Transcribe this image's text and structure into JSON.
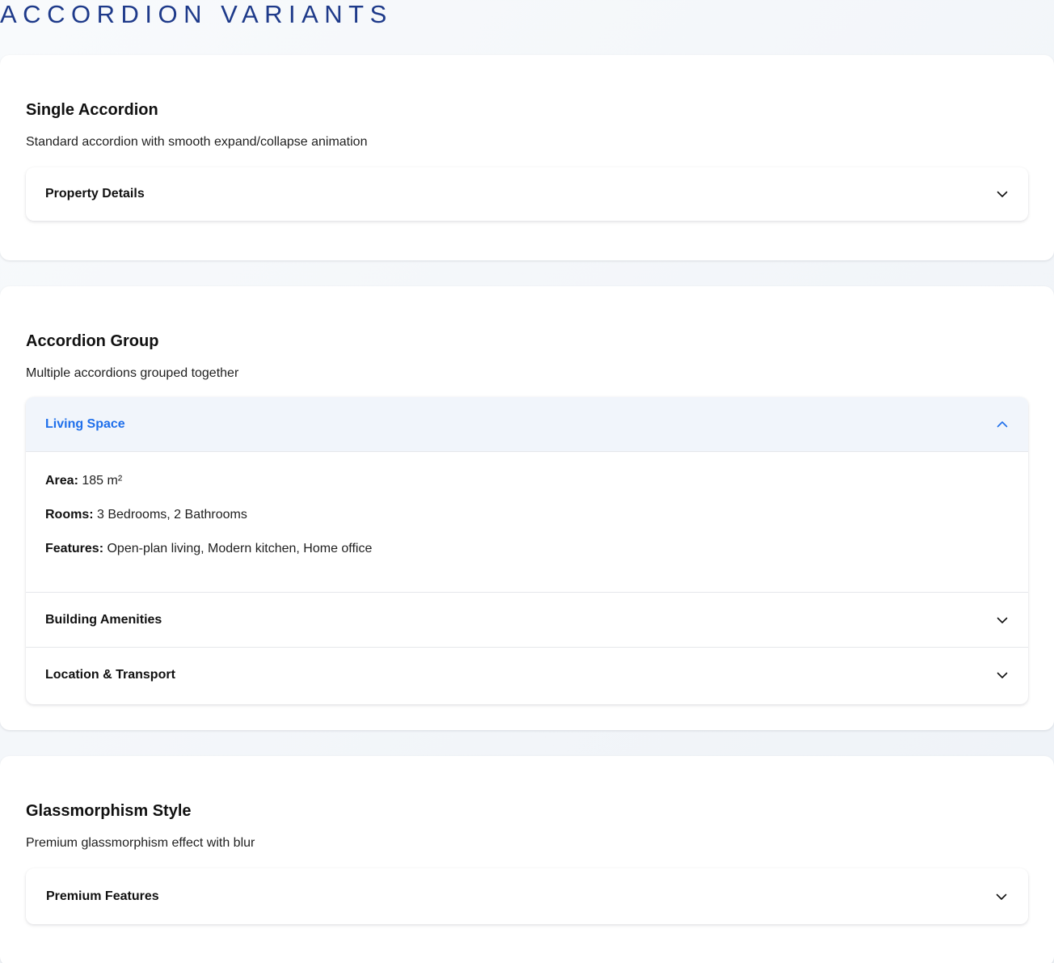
{
  "page": {
    "title": "ACCORDION VARIANTS"
  },
  "sections": {
    "single": {
      "title": "Single Accordion",
      "description": "Standard accordion with smooth expand/collapse animation",
      "items": [
        {
          "label": "Property Details",
          "expanded": false
        }
      ]
    },
    "group": {
      "title": "Accordion Group",
      "description": "Multiple accordions grouped together",
      "items": [
        {
          "label": "Living Space",
          "expanded": true,
          "content": [
            {
              "key": "Area:",
              "value": "185 m²"
            },
            {
              "key": "Rooms:",
              "value": "3 Bedrooms, 2 Bathrooms"
            },
            {
              "key": "Features:",
              "value": "Open-plan living, Modern kitchen, Home office"
            }
          ]
        },
        {
          "label": "Building Amenities",
          "expanded": false
        },
        {
          "label": "Location & Transport",
          "expanded": false
        }
      ]
    },
    "glass": {
      "title": "Glassmorphism Style",
      "description": "Premium glassmorphism effect with blur",
      "items": [
        {
          "label": "Premium Features",
          "expanded": false
        }
      ]
    }
  },
  "icons": {
    "collapsed": "chevron-down-icon",
    "expanded": "chevron-up-icon"
  },
  "colors": {
    "title": "#1e3a8a",
    "active": "#1f6feb",
    "active_bg": "#f1f5fb"
  }
}
